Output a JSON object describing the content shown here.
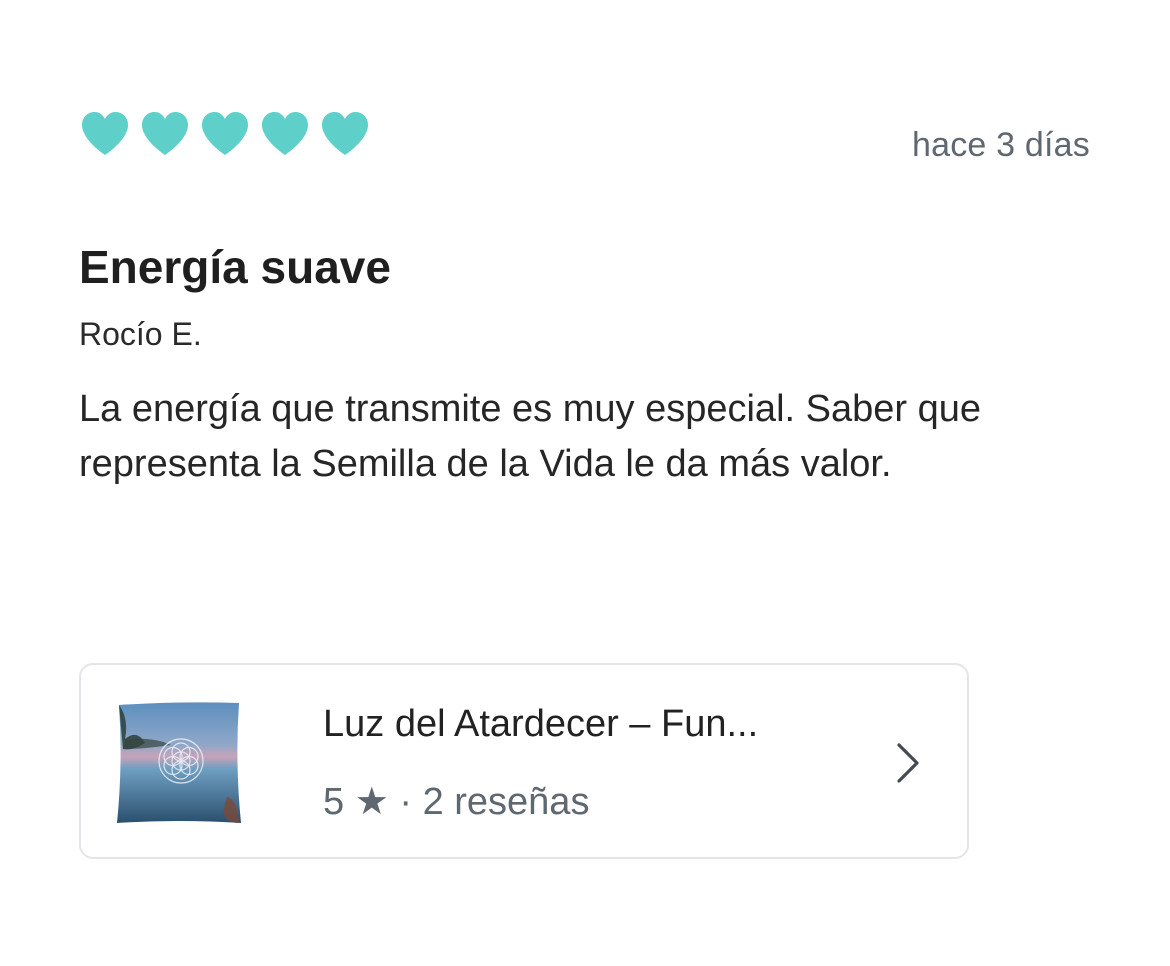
{
  "review": {
    "rating": 5,
    "rating_max": 5,
    "rating_icon": "heart-icon",
    "accent_color": "#5ecfc9",
    "date": "hace 3 días",
    "title": "Energía suave",
    "author": "Rocío E.",
    "body": "La energía que transmite es muy especial. Saber que representa la Semilla de la Vida le da más valor."
  },
  "product": {
    "name": "Luz del Atardecer – Fun...",
    "rating_value": "5",
    "star_glyph": "★",
    "separator": "·",
    "reviews_label": "2 reseñas",
    "thumbnail_icon": "pillow-thumbnail",
    "chevron_icon": "chevron-right-icon"
  }
}
